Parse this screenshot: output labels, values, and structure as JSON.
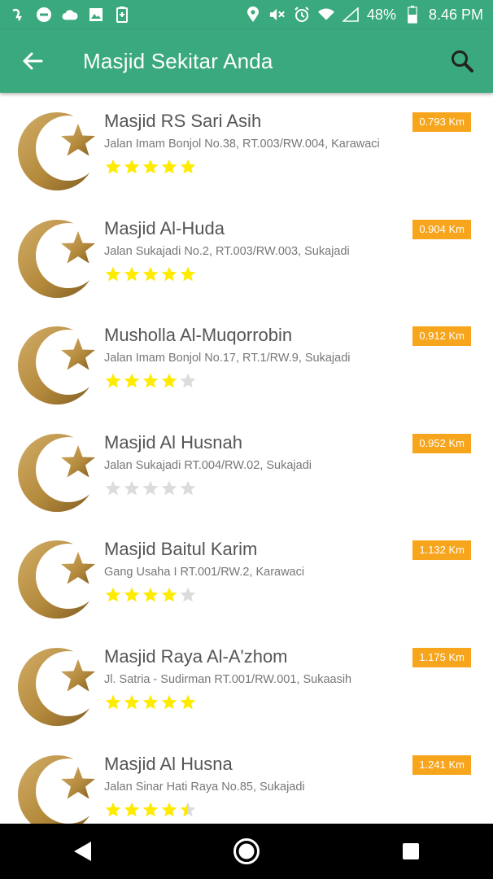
{
  "status_bar": {
    "battery": "48%",
    "time": "8.46 PM",
    "icons": [
      "notification-icon",
      "dnd-icon",
      "cloud-icon",
      "image-icon",
      "battery-saver-icon",
      "location-icon",
      "mute-icon",
      "alarm-icon",
      "wifi-icon",
      "signal-icon",
      "battery-icon"
    ]
  },
  "app_bar": {
    "title": "Masjid Sekitar Anda",
    "back_icon": "arrow-left-icon",
    "search_icon": "search-icon"
  },
  "colors": {
    "primary": "#3aa97d",
    "distance_badge": "#f7a51c",
    "star_filled": "#ffeb00",
    "star_empty": "#dcdcdc",
    "logo_gold": "#b48a3c"
  },
  "mosques": [
    {
      "name": "Masjid RS Sari Asih",
      "address": "Jalan Imam Bonjol No.38, RT.003/RW.004, Karawaci",
      "distance": "0.793 Km",
      "rating": 5
    },
    {
      "name": "Masjid Al-Huda",
      "address": "Jalan Sukajadi No.2, RT.003/RW.003, Sukajadi",
      "distance": "0.904 Km",
      "rating": 5
    },
    {
      "name": "Musholla Al-Muqorrobin",
      "address": "Jalan Imam Bonjol No.17, RT.1/RW.9, Sukajadi",
      "distance": "0.912 Km",
      "rating": 4
    },
    {
      "name": "Masjid Al Husnah",
      "address": "Jalan Sukajadi RT.004/RW.02, Sukajadi",
      "distance": "0.952 Km",
      "rating": 0
    },
    {
      "name": "Masjid Baitul Karim",
      "address": "Gang Usaha I RT.001/RW.2, Karawaci",
      "distance": "1.132 Km",
      "rating": 4
    },
    {
      "name": "Masjid Raya Al-A'zhom",
      "address": "Jl. Satria - Sudirman RT.001/RW.001, Sukaasih",
      "distance": "1.175 Km",
      "rating": 5
    },
    {
      "name": "Masjid Al Husna",
      "address": "Jalan Sinar Hati Raya No.85, Sukajadi",
      "distance": "1.241 Km",
      "rating": 4.5
    }
  ],
  "nav_bar": {
    "back_icon": "triangle-back-icon",
    "home_icon": "circle-home-icon",
    "recents_icon": "square-recents-icon"
  }
}
